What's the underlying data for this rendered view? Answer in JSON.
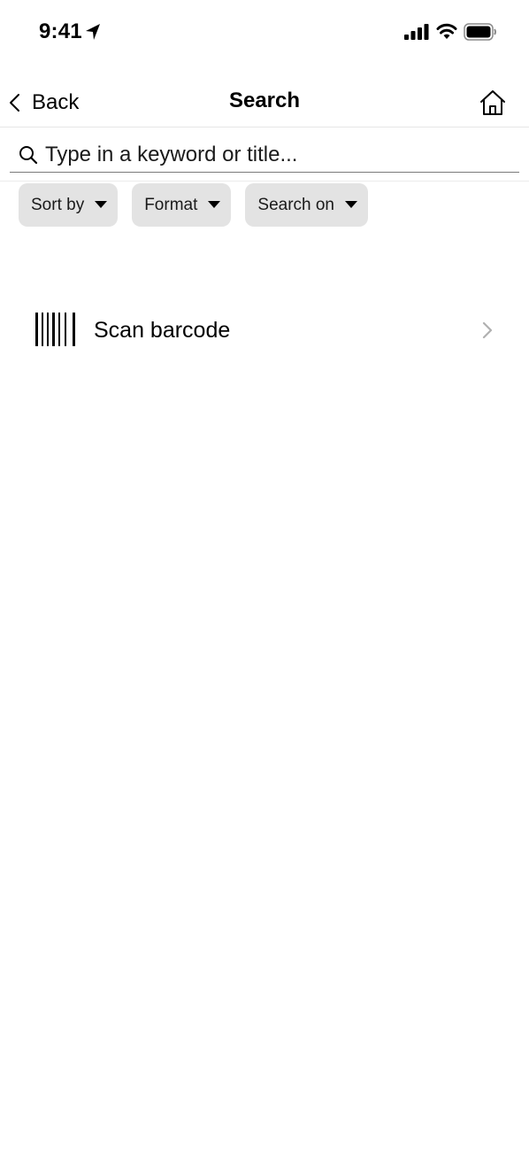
{
  "status_bar": {
    "time": "9:41",
    "icons": [
      "location-arrow-icon",
      "cellular-signal-icon",
      "wifi-icon",
      "battery-icon"
    ]
  },
  "nav": {
    "back_label": "Back",
    "title": "Search",
    "home_icon": "home-icon"
  },
  "search": {
    "placeholder": "Type in a keyword or title..."
  },
  "filters": [
    {
      "label": "Sort by"
    },
    {
      "label": "Format"
    },
    {
      "label": "Search on"
    }
  ],
  "scan": {
    "label": "Scan barcode",
    "icon": "barcode-icon"
  },
  "colors": {
    "chip_background": "#e3e3e3",
    "chevron_gray": "#b0b0b0",
    "divider": "#e6e6e6"
  }
}
